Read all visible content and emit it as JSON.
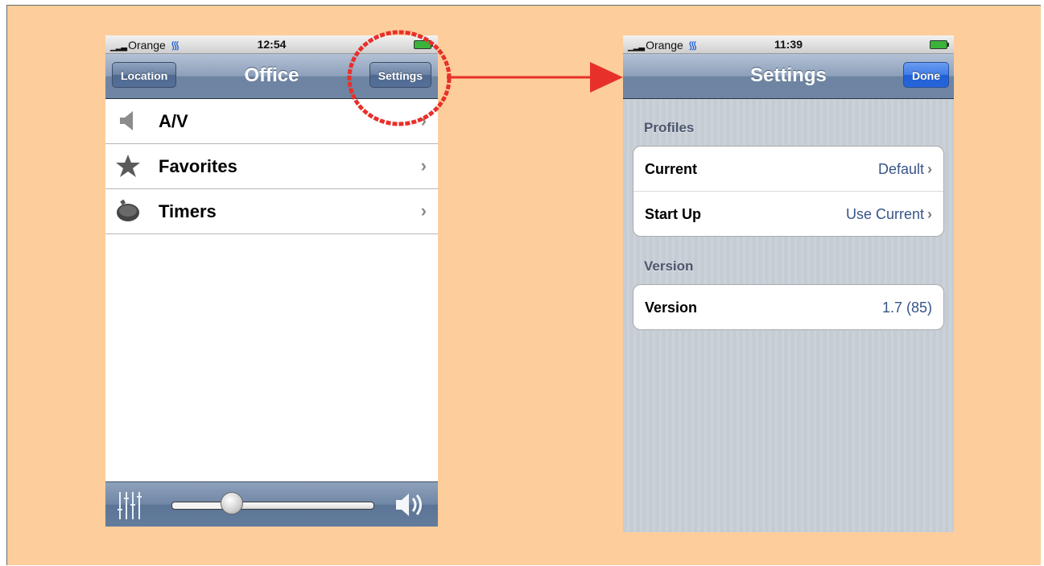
{
  "left_phone": {
    "status": {
      "carrier": "Orange",
      "time": "12:54"
    },
    "nav": {
      "title": "Office",
      "left_button": "Location",
      "right_button": "Settings"
    },
    "items": [
      {
        "label": "A/V",
        "icon": "speaker-icon"
      },
      {
        "label": "Favorites",
        "icon": "star-icon"
      },
      {
        "label": "Timers",
        "icon": "stopwatch-icon"
      }
    ],
    "volume": {
      "level": 0.3
    }
  },
  "right_phone": {
    "status": {
      "carrier": "Orange",
      "time": "11:39"
    },
    "nav": {
      "title": "Settings",
      "right_button": "Done"
    },
    "sections": [
      {
        "header": "Profiles",
        "rows": [
          {
            "label": "Current",
            "value": "Default"
          },
          {
            "label": "Start Up",
            "value": "Use Current"
          }
        ]
      },
      {
        "header": "Version",
        "rows": [
          {
            "label": "Version",
            "value": "1.7 (85)"
          }
        ]
      }
    ]
  },
  "annotation": {
    "color": "#e8302a"
  }
}
